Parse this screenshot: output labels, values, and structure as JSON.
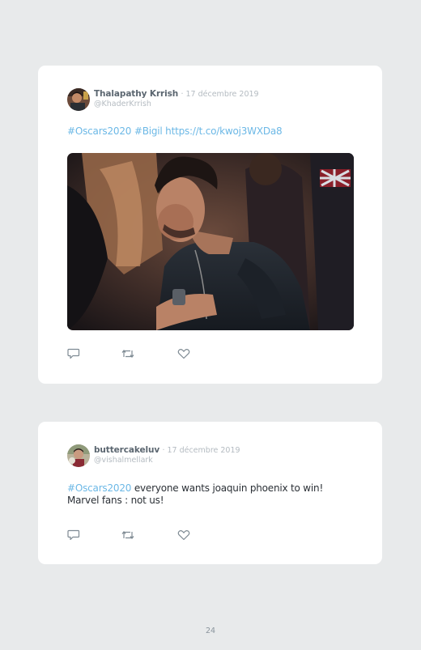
{
  "tweets": [
    {
      "display_name": "Thalapathy Krrish",
      "date": "· 17 décembre 2019",
      "handle": "@KhaderKrrish",
      "text_lines": [
        [
          {
            "text": "#Oscars2020 #Bigil https://t.co/kwoj3WXDa8",
            "type": "link"
          }
        ]
      ],
      "has_media": true,
      "avatar_icon": "user-avatar-photo",
      "actions": [
        "reply-icon",
        "retweet-icon",
        "like-icon"
      ]
    },
    {
      "display_name": "buttercakeluv",
      "date": "· 17 décembre 2019",
      "handle": "@vishalmellark",
      "text_lines": [
        [
          {
            "text": "#Oscars2020",
            "type": "link"
          },
          {
            "text": " everyone wants joaquin phoenix to win!",
            "type": "plain"
          }
        ],
        [
          {
            "text": "Marvel fans : not us!",
            "type": "plain"
          }
        ]
      ],
      "has_media": false,
      "avatar_icon": "user-avatar-photo",
      "actions": [
        "reply-icon",
        "retweet-icon",
        "like-icon"
      ]
    }
  ],
  "page_number": "24",
  "colors": {
    "background": "#e8eaeb",
    "card": "#ffffff",
    "link": "#6cb8e6",
    "name": "#5b6670",
    "muted": "#b4bbc1",
    "icon": "#7e8a93"
  }
}
